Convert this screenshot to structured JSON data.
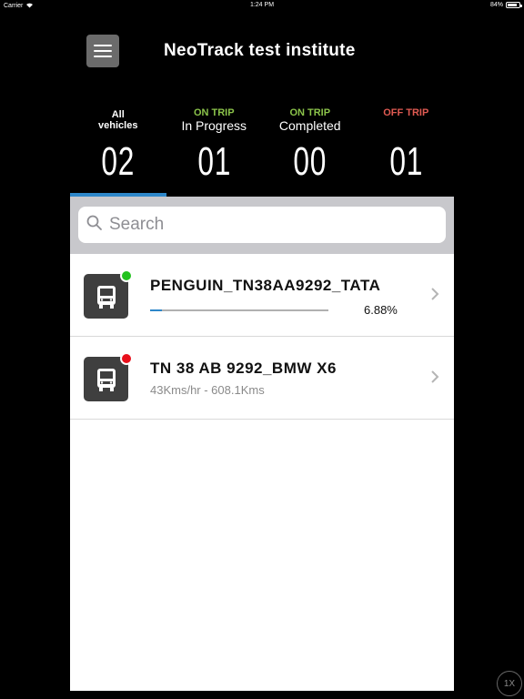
{
  "status_bar": {
    "carrier": "Carrier",
    "time": "1:24 PM",
    "battery": "84%",
    "battery_level": 0.84
  },
  "header": {
    "title": "NeoTrack test institute"
  },
  "tabs": [
    {
      "top": "All",
      "sub": "vehicles",
      "count": "02",
      "color": "#ffffff",
      "active": true
    },
    {
      "top": "ON TRIP",
      "sub": "In Progress",
      "count": "01",
      "color": "#8bc34a",
      "active": false
    },
    {
      "top": "ON TRIP",
      "sub": "Completed",
      "count": "00",
      "color": "#8bc34a",
      "active": false
    },
    {
      "top": "OFF TRIP",
      "sub": "",
      "count": "01",
      "color": "#e05a52",
      "active": false
    }
  ],
  "search": {
    "placeholder": "Search"
  },
  "vehicles": [
    {
      "name": "PENGUIN_TN38AA9292_TATA",
      "status_color": "#22c21e",
      "progress": 0.0688,
      "progress_label": "6.88%",
      "subtitle": ""
    },
    {
      "name": "TN 38 AB 9292_BMW X6",
      "status_color": "#e8101b",
      "progress": null,
      "progress_label": "",
      "subtitle": "43Kms/hr - 608.1Kms"
    }
  ],
  "speed_badge": "1X",
  "icons": {
    "menu": "hamburger-icon",
    "search": "search-icon",
    "vehicle": "bus-icon",
    "chevron": "chevron-right-icon",
    "wifi": "wifi-icon",
    "battery": "battery-icon"
  }
}
